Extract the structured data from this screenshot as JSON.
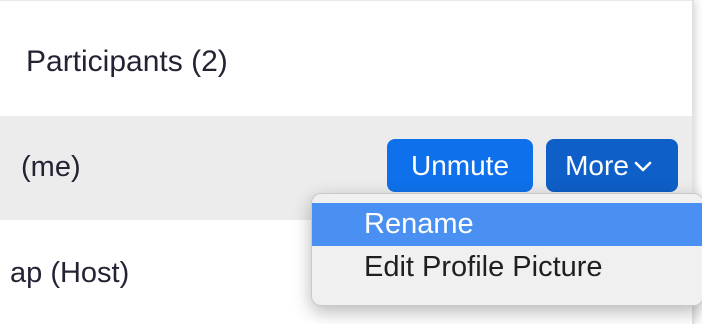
{
  "participants": {
    "title": "Participants (2)",
    "rows": [
      {
        "name": "(me)",
        "actions": {
          "unmute_label": "Unmute",
          "more_label": "More"
        }
      },
      {
        "name": "ap (Host)"
      }
    ]
  },
  "context_menu": {
    "items": [
      {
        "label": "Rename",
        "selected": true
      },
      {
        "label": "Edit Profile Picture",
        "selected": false
      }
    ]
  },
  "colors": {
    "unmute_button": "#0e71eb",
    "more_button": "#0e5fc7",
    "menu_highlight": "#4a8ff2",
    "row_highlight": "#ececec"
  },
  "icons": {
    "more_dropdown": "chevron-down-icon"
  }
}
